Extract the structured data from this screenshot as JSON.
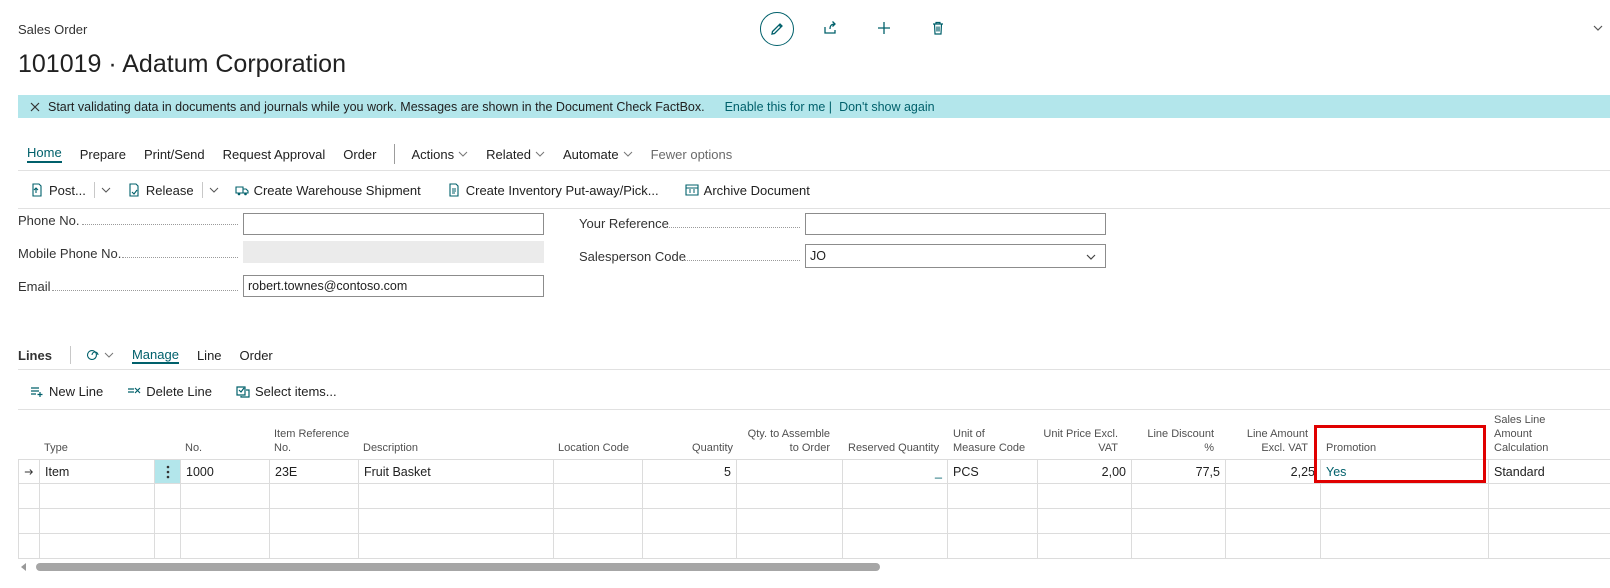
{
  "page": {
    "caption": "Sales Order",
    "title": "101019 · Adatum Corporation"
  },
  "banner": {
    "message": "Start validating data in documents and journals while you work. Messages are shown in the Document Check FactBox.",
    "enable_link": "Enable this for me |",
    "dont_show_link": "Don't show again"
  },
  "nav": {
    "home": "Home",
    "prepare": "Prepare",
    "print_send": "Print/Send",
    "request_approval": "Request Approval",
    "order": "Order",
    "actions": "Actions",
    "related": "Related",
    "automate": "Automate",
    "fewer_options": "Fewer options"
  },
  "actions": {
    "post": "Post...",
    "release": "Release",
    "create_warehouse_shipment": "Create Warehouse Shipment",
    "create_inventory_putaway": "Create Inventory Put-away/Pick...",
    "archive_document": "Archive Document"
  },
  "fields": {
    "phone_label": "Phone No.",
    "phone_value": "",
    "mobile_label": "Mobile Phone No.",
    "mobile_value": "",
    "email_label": "Email",
    "email_value": "robert.townes@contoso.com",
    "your_reference_label": "Your Reference",
    "your_reference_value": "",
    "salesperson_label": "Salesperson Code",
    "salesperson_value": "JO"
  },
  "lines": {
    "title": "Lines",
    "manage": "Manage",
    "line": "Line",
    "order": "Order",
    "new_line": "New Line",
    "delete_line": "Delete Line",
    "select_items": "Select items...",
    "headers": {
      "type": "Type",
      "no": "No.",
      "item_ref_1": "Item Reference",
      "item_ref_2": "No.",
      "description": "Description",
      "location_code": "Location Code",
      "quantity": "Quantity",
      "qty_assemble_1": "Qty. to Assemble",
      "qty_assemble_2": "to Order",
      "reserved_quantity": "Reserved Quantity",
      "uom_1": "Unit of",
      "uom_2": "Measure Code",
      "unit_price_1": "Unit Price Excl.",
      "unit_price_2": "VAT",
      "line_discount": "Line Discount %",
      "line_amount_1": "Line Amount",
      "line_amount_2": "Excl. VAT",
      "promotion": "Promotion",
      "calc_1": "Sales Line",
      "calc_2": "Amount",
      "calc_3": "Calculation"
    },
    "row1": {
      "type": "Item",
      "no": "1000",
      "item_ref": "23E",
      "description": "Fruit Basket",
      "location_code": "",
      "quantity": "5",
      "qty_assemble": "",
      "reserved_quantity": "_",
      "uom": "PCS",
      "unit_price": "2,00",
      "line_discount": "77,5",
      "line_amount": "2,25",
      "promotion": "Yes",
      "calc": "Standard"
    }
  },
  "colors": {
    "accent": "#00606b",
    "banner_bg": "#b3e6eb",
    "highlight": "#e00000"
  }
}
